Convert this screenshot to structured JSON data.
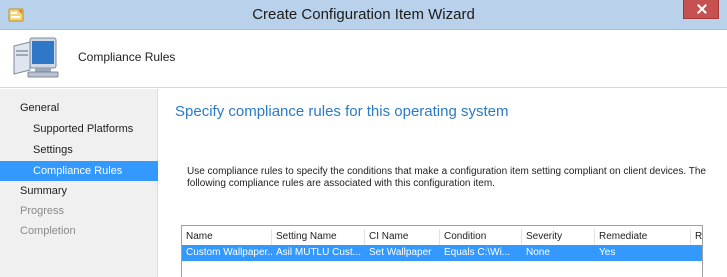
{
  "window": {
    "title": "Create Configuration Item Wizard"
  },
  "header": {
    "title": "Compliance Rules"
  },
  "nav": {
    "items": [
      {
        "label": "General",
        "state": "normal"
      },
      {
        "label": "Supported Platforms",
        "state": "normal"
      },
      {
        "label": "Settings",
        "state": "normal"
      },
      {
        "label": "Compliance Rules",
        "state": "selected"
      },
      {
        "label": "Summary",
        "state": "normal"
      },
      {
        "label": "Progress",
        "state": "disabled"
      },
      {
        "label": "Completion",
        "state": "disabled"
      }
    ]
  },
  "main": {
    "heading": "Specify compliance rules for this operating system",
    "description": "Use compliance rules to specify the conditions that make a configuration item setting compliant on client devices. The following compliance rules are associated with this configuration item."
  },
  "rules_table": {
    "columns": [
      "Name",
      "Setting Name",
      "CI Name",
      "Condition",
      "Severity",
      "Remediate",
      "R"
    ],
    "rows": [
      [
        "Custom Wallpaper...",
        "Asil MUTLU Cust...",
        "Set Wallpaper",
        "Equals C:\\Wi...",
        "None",
        "Yes",
        ""
      ]
    ]
  },
  "colors": {
    "titlebar": "#b9d1ea",
    "selection": "#3399ff",
    "heading": "#2a7bc4",
    "close_button": "#c75050"
  },
  "icons": {
    "app": "configuration-item-icon",
    "header": "computer-monitor-icon",
    "close": "close-icon"
  }
}
